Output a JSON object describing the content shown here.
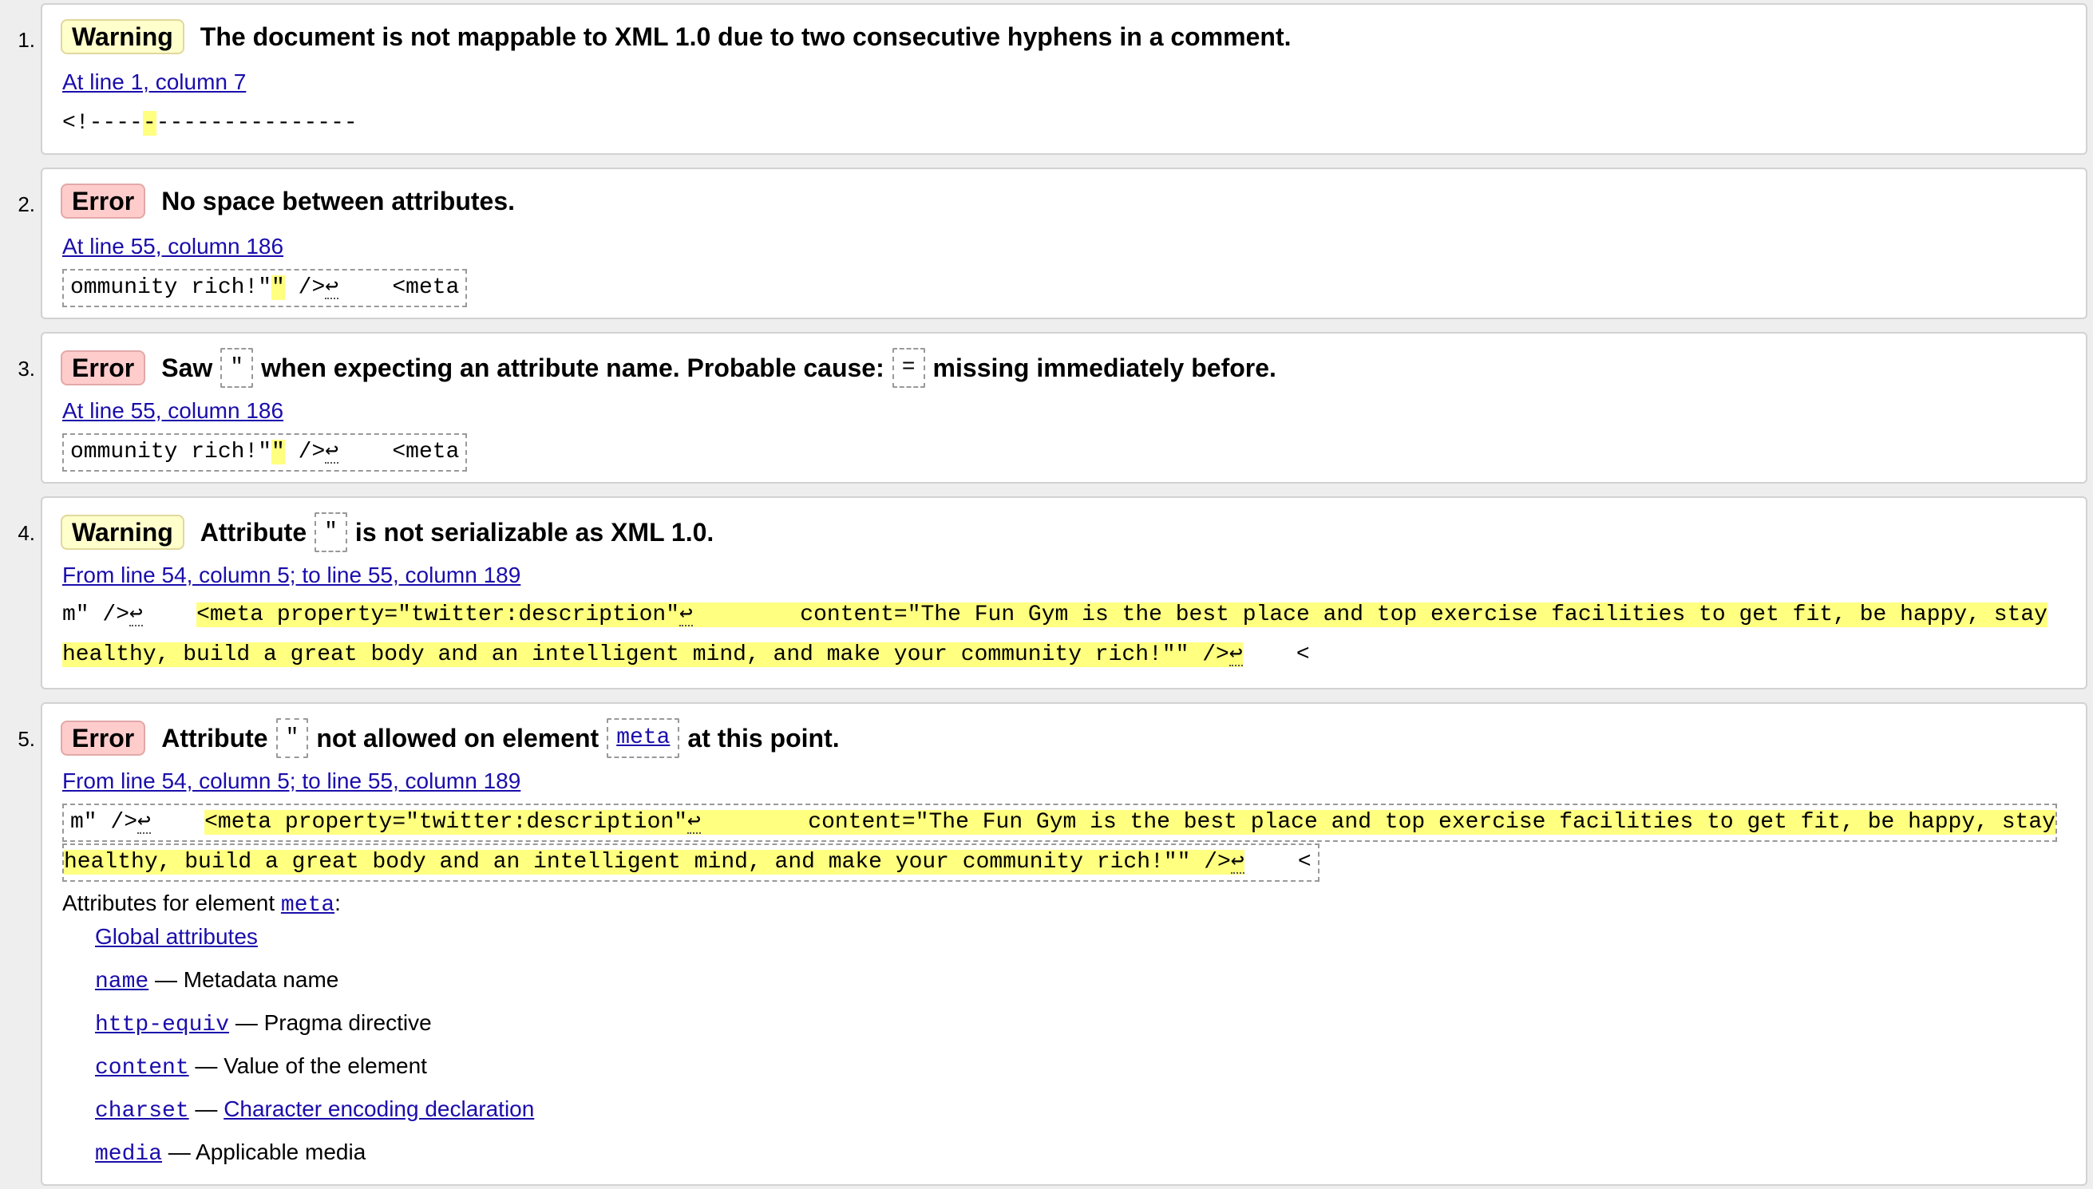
{
  "messages": [
    {
      "number": "1.",
      "type": "Warning",
      "text": "The document is not mappable to XML 1.0 due to two consecutive hyphens in a comment.",
      "location": "At line 1, column 7",
      "extract_before": "<!----",
      "extract_highlight": "-",
      "extract_after": "---------------"
    },
    {
      "number": "2.",
      "type": "Error",
      "text": "No space between attributes.",
      "location": "At line 55, column 186",
      "extract_before": "ommunity rich!\"",
      "extract_highlight": "\"",
      "extract_after": " />",
      "extract_return": "↩",
      "extract_tail": "    <meta"
    },
    {
      "number": "3.",
      "type": "Error",
      "text_part1": "Saw",
      "text_code1": "\"",
      "text_part2": "when expecting an attribute name. Probable cause:",
      "text_code2": "=",
      "text_part3": "missing immediately before.",
      "location": "At line 55, column 186",
      "extract_before": "ommunity rich!\"",
      "extract_highlight": "\"",
      "extract_after": " />",
      "extract_return": "↩",
      "extract_tail": "    <meta"
    },
    {
      "number": "4.",
      "type": "Warning",
      "text_part1": "Attribute",
      "text_code1": "\"",
      "text_part2": "is not serializable as XML 1.0.",
      "location": "From line 54, column 5; to line 55, column 189",
      "extract_line1_pre": "m\" />",
      "extract_return": "↩",
      "extract_line1_gap": "    ",
      "extract_line1_hl_a": "<meta property=\"twitter:description\"",
      "extract_line1_hl_b": "        content=\"The Fun Gym is the best place and top exercise facilities to get fit, be happy, stay",
      "extract_line2_hl": "healthy, build a great body and an intelligent mind, and make your community rich!\"\" />",
      "extract_line2_tail": "    <"
    },
    {
      "number": "5.",
      "type": "Error",
      "text_part1": "Attribute",
      "text_code1": "\"",
      "text_part2": "not allowed on element",
      "text_code2": "meta",
      "text_part3": "at this point.",
      "location": "From line 54, column 5; to line 55, column 189",
      "extract_line1_pre": "m\" />",
      "extract_return": "↩",
      "extract_line1_gap": "    ",
      "extract_line1_hl_a": "<meta property=\"twitter:description\"",
      "extract_line1_hl_b": "        content=\"The Fun Gym is the best place and top exercise facilities to get fit, be happy, stay",
      "extract_line2_hl": "healthy, build a great body and an intelligent mind, and make your community rich!\"\" />",
      "extract_line2_tail": "    <",
      "attributes_title": "Attributes for element",
      "attributes_element": "meta",
      "attributes_colon": ":",
      "global_attributes": "Global attributes",
      "attributes": [
        {
          "name": "name",
          "desc": "Metadata name"
        },
        {
          "name": "http-equiv",
          "desc": "Pragma directive"
        },
        {
          "name": "content",
          "desc": "Value of the element"
        },
        {
          "name": "charset",
          "desc": "Character encoding declaration"
        },
        {
          "name": "media",
          "desc": "Applicable media"
        }
      ],
      "dash": "—"
    }
  ],
  "colors": {
    "warning_bg": "#ffffcc",
    "error_bg": "#ffcccc",
    "highlight": "#ffff80",
    "link": "#1a0dab"
  }
}
